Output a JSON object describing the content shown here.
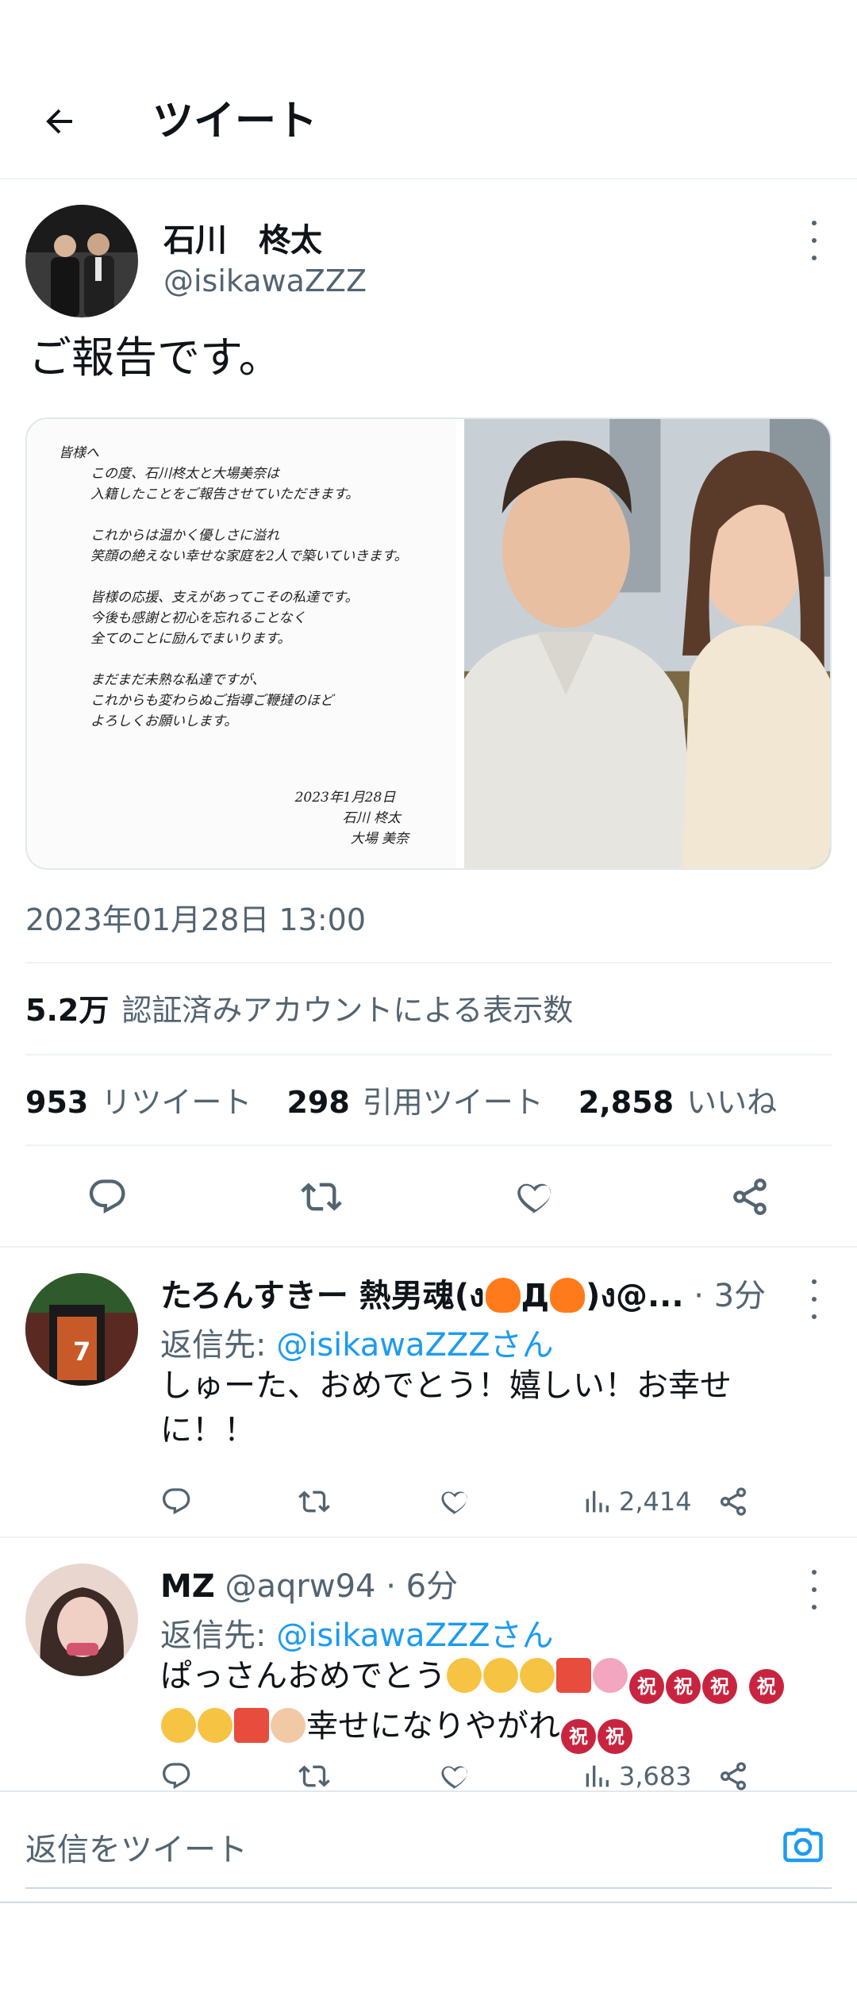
{
  "header": {
    "title": "ツイート"
  },
  "tweet": {
    "author_name": "石川　柊太",
    "author_handle": "@isikawaZZZ",
    "text": "ご報告です。",
    "letter": {
      "lines": [
        "皆様へ",
        "この度、石川柊太と大場美奈は",
        "入籍したことをご報告させていただきます。",
        "",
        "これからは温かく優しさに溢れ",
        "笑顔の絶えない幸せな家庭を2人で築いていきます。",
        "",
        "皆様の応援、支えがあってこその私達です。",
        "今後も感謝と初心を忘れることなく",
        "全てのことに励んでまいります。",
        "",
        "まだまだ未熟な私達ですが、",
        "これからも変わらぬご指導ご鞭撻のほど",
        "よろしくお願いします。"
      ],
      "date": "2023年1月28日",
      "sign1": "石川 柊太",
      "sign2": "大場 美奈"
    },
    "timestamp": "2023年01月28日 13:00",
    "views_value": "5.2万",
    "views_label": "認証済みアカウントによる表示数",
    "retweets_value": "953",
    "retweets_label": "リツイート",
    "quotes_value": "298",
    "quotes_label": "引用ツイート",
    "likes_value": "2,858",
    "likes_label": "いいね"
  },
  "replies": [
    {
      "name": "たろんすきー 熱男魂(ง",
      "name_mid": "Д",
      "name_end": ")ง@...",
      "time": " · 3分",
      "reply_prefix": "返信先: ",
      "reply_handle": "@isikawaZZZさん",
      "text": "しゅーた、おめでとう！嬉しい！お幸せに！！",
      "views": "2,414"
    },
    {
      "name": "MZ",
      "handle": "@aqrw94",
      "time": " · 6分",
      "reply_prefix": "返信先: ",
      "reply_handle": "@isikawaZZZさん",
      "text1": "ぱっさんおめでとう",
      "text2": "幸せになりやがれ",
      "iwai": "祝",
      "views": "3,683"
    }
  ],
  "compose": {
    "placeholder": "返信をツイート"
  },
  "colors": {
    "accent": "#1d9bf0",
    "text": "#0f1419",
    "muted": "#536471",
    "divider": "#eff3f4"
  },
  "icons": [
    "back-arrow-icon",
    "more-icon",
    "reply-icon",
    "retweet-icon",
    "like-icon",
    "share-icon",
    "views-icon",
    "camera-icon"
  ]
}
